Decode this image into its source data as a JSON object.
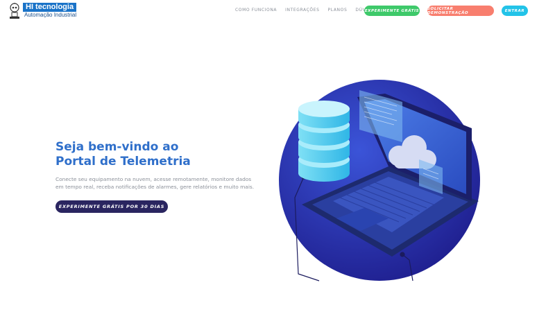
{
  "header": {
    "logo": {
      "brand": "HI tecnologia",
      "subtitle": "Automação Industrial"
    },
    "nav": [
      "COMO FUNCIONA",
      "INTEGRAÇÕES",
      "PLANOS",
      "DÚVIDAS"
    ],
    "buttons": {
      "trial": "EXPERIMENTE GRÁTIS",
      "demo": "SOLICITAR DEMONSTRAÇÃO",
      "login": "ENTRAR"
    }
  },
  "hero": {
    "title_line1": "Seja bem-vindo ao",
    "title_line2": "Portal de Telemetria",
    "desc_line1": "Conecte seu equipamento na nuvem, acesse remotamente, monitore dados",
    "desc_line2": "em tempo real, receba notificações de alarmes, gere relatórios e muito mais.",
    "cta": "EXPERIMENTE GRÁTIS POR 30 DIAS"
  },
  "illustration": {
    "icons": [
      "database-icon",
      "laptop-icon",
      "cloud-icon"
    ]
  },
  "colors": {
    "primary_blue": "#2f6fca",
    "logo_blue": "#1a73c8",
    "green": "#3ec96a",
    "coral": "#f87e6e",
    "cyan": "#22c3e8",
    "cta_dark": "#2a2560",
    "circle_blue": "#2b2fa8"
  }
}
